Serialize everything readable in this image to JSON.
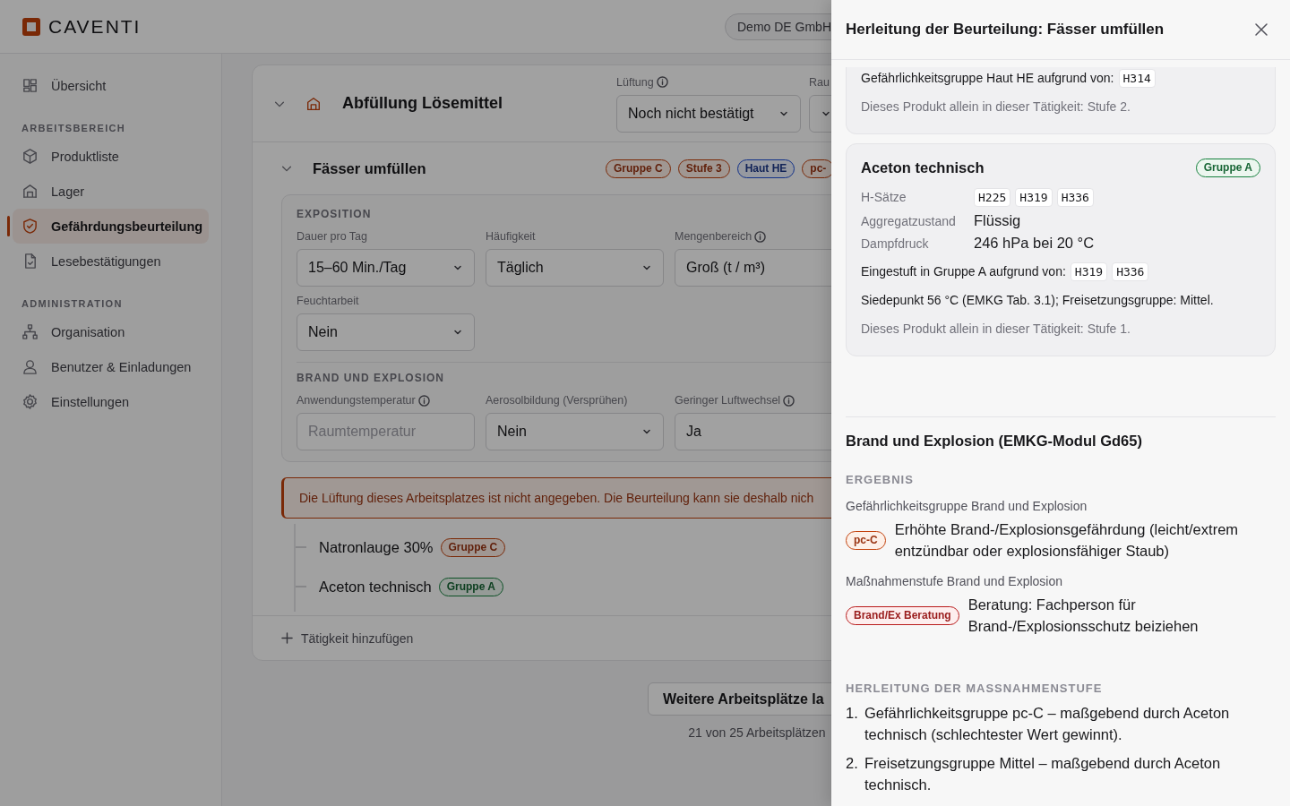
{
  "header": {
    "logo": "CAVENTI",
    "org": "Demo DE GmbH"
  },
  "sidebar": {
    "sections": [
      {
        "items": [
          {
            "label": "Übersicht",
            "selected": false
          }
        ]
      },
      {
        "title": "ARBEITSBEREICH",
        "items": [
          {
            "label": "Produktliste",
            "selected": false
          },
          {
            "label": "Lager",
            "selected": false
          },
          {
            "label": "Gefährdungsbeurteilung",
            "selected": true
          },
          {
            "label": "Lesebestätigungen",
            "selected": false
          }
        ]
      },
      {
        "title": "ADMINISTRATION",
        "items": [
          {
            "label": "Organisation",
            "selected": false
          },
          {
            "label": "Benutzer & Einladungen",
            "selected": false
          },
          {
            "label": "Einstellungen",
            "selected": false
          }
        ]
      }
    ]
  },
  "workplace": {
    "title": "Abfüllung Lösemittel",
    "expanded": true,
    "fields": [
      {
        "label": "Lüftung",
        "info": true,
        "kind": "select",
        "value": "Noch nicht bestätigt"
      },
      {
        "label": "Rau",
        "kind": "select"
      }
    ],
    "activity": {
      "title": "Fässer umfüllen",
      "expanded": true,
      "badges": [
        {
          "text": "Gruppe C",
          "kind": "warning"
        },
        {
          "text": "Stufe 3",
          "kind": "warning"
        },
        {
          "text": "Haut HE",
          "kind": "info"
        },
        {
          "text": "pc-",
          "kind": "warning"
        }
      ],
      "sections": [
        {
          "title": "EXPOSITION",
          "fields": [
            {
              "label": "Dauer pro Tag",
              "info": false,
              "kind": "select",
              "value": "15–60 Min./Tag"
            },
            {
              "label": "Häufigkeit",
              "info": false,
              "kind": "select",
              "value": "Täglich"
            },
            {
              "label": "Mengenbereich",
              "info": true,
              "kind": "select",
              "value": "Groß (t / m³)"
            },
            {
              "label": "Feuchtarbeit",
              "info": false,
              "kind": "select",
              "value": "Nein"
            }
          ]
        },
        {
          "title": "BRAND UND EXPLOSION",
          "fields": [
            {
              "label": "Anwendungstemperatur",
              "info": true,
              "kind": "text",
              "placeholder": "Raumtemperatur"
            },
            {
              "label": "Aerosolbildung (Versprühen)",
              "info": false,
              "kind": "select",
              "value": "Nein"
            },
            {
              "label": "Geringer Luftwechsel",
              "info": true,
              "kind": "text",
              "value": "Ja"
            }
          ]
        }
      ],
      "warning": "Die Lüftung dieses Arbeitsplatzes ist nicht angegeben. Die Beurteilung kann sie deshalb nich",
      "products": [
        {
          "name": "Natronlauge 30%",
          "badge": {
            "text": "Gruppe C",
            "kind": "warning"
          }
        },
        {
          "name": "Aceton technisch",
          "badge": {
            "text": "Gruppe A",
            "kind": "success"
          }
        }
      ]
    },
    "add_activity": "Tätigkeit hinzufügen"
  },
  "load_more": "Weitere Arbeitsplätze la",
  "count": "21 von 25 Arbeitsplätzen",
  "drawer": {
    "title": "Herleitung der Beurteilung: Fässer umfüllen",
    "products": [
      {
        "lines": [
          {
            "kind": "codes",
            "text": "Gefährlichkeitsgruppe Haut HE aufgrund von:",
            "codes": [
              "H314"
            ]
          },
          {
            "kind": "note",
            "text": "Dieses Produkt allein in dieser Tätigkeit: Stufe 2."
          }
        ]
      },
      {
        "name": "Aceton technisch",
        "badge": {
          "text": "Gruppe A",
          "kind": "success"
        },
        "properties": [
          {
            "label": "H-Sätze",
            "codes": [
              "H225",
              "H319",
              "H336"
            ]
          },
          {
            "label": "Aggregatzustand",
            "value": "Flüssig"
          },
          {
            "label": "Dampfdruck",
            "value": "246 hPa bei 20 °C"
          }
        ],
        "lines": [
          {
            "kind": "codes",
            "text": "Eingestuft in Gruppe A aufgrund von:",
            "codes": [
              "H319",
              "H336"
            ]
          },
          {
            "kind": "text",
            "text": "Siedepunkt 56 °C (EMKG Tab. 3.1); Freisetzungsgruppe: Mittel."
          },
          {
            "kind": "note",
            "text": "Dieses Produkt allein in dieser Tätigkeit: Stufe 1."
          }
        ]
      }
    ],
    "fire": {
      "title": "Brand und Explosion (EMKG-Modul Gd65)",
      "result_title": "ERGEBNIS",
      "results": [
        {
          "label": "Gefährlichkeitsgruppe Brand und Explosion",
          "badge": {
            "text": "pc-C",
            "kind": "warning"
          },
          "text": "Erhöhte Brand-/Explosionsgefährdung (leicht/extrem entzündbar oder explosionsfähiger Staub)"
        },
        {
          "label": "Maßnahmenstufe Brand und Explosion",
          "badge": {
            "text": "Brand/Ex Beratung",
            "kind": "danger"
          },
          "text": "Beratung: Fachperson für Brand-/Explosionsschutz beiziehen"
        }
      ],
      "derivation_title": "HERLEITUNG DER MASSNAHMENSTUFE",
      "steps": [
        {
          "number": "1.",
          "text": "Gefährlichkeitsgruppe pc-C – maßgebend durch Aceton technisch (schlechtester Wert gewinnt)."
        },
        {
          "number": "2.",
          "text": "Freisetzungsgruppe Mittel – maßgebend durch Aceton technisch."
        }
      ]
    }
  }
}
